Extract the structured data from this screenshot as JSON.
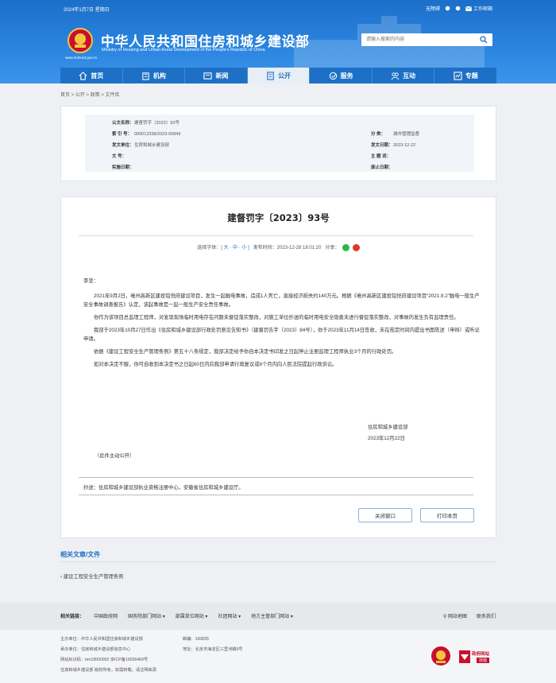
{
  "topbar": {
    "date": "2024年1月7日 星期日",
    "accessibility": "无障碍",
    "weibo": "微博",
    "wechat": "",
    "mail": "工作邮箱"
  },
  "site": {
    "title": "中华人民共和国住房和城乡建设部",
    "subtitle": "Ministry of Housing and Urban-Rural Development of the People's Republic of China",
    "domain": "www.mohurd.gov.cn"
  },
  "search": {
    "placeholder": "请输入搜索的内容"
  },
  "nav": [
    {
      "label": "首页",
      "icon": "home-icon"
    },
    {
      "label": "机构",
      "icon": "building-icon"
    },
    {
      "label": "新闻",
      "icon": "news-icon"
    },
    {
      "label": "公开",
      "icon": "publish-icon"
    },
    {
      "label": "服务",
      "icon": "service-icon"
    },
    {
      "label": "互动",
      "icon": "interact-icon"
    },
    {
      "label": "专题",
      "icon": "topic-icon"
    }
  ],
  "breadcrumb": "首页 > 公开 > 政策 > 文件库",
  "info": {
    "doc_name_label": "公文名称：",
    "doc_name": "建督罚字〔2023〕93号",
    "index_label": "索  引  号：",
    "index": "000013338/2023-00849",
    "issuer_label": "发文单位：",
    "issuer": "住房和城乡建设部",
    "docno_label": "文      号：",
    "docno": "",
    "effective_label": "实施日期：",
    "effective": "",
    "category_label": "分      类：",
    "category": "城市管理监督",
    "date_label": "发文日期：",
    "date": "2023-12-22",
    "keywords_label": "主  题  词：",
    "keywords": "",
    "expiry_label": "废止日期：",
    "expiry": ""
  },
  "doc": {
    "title": "建督罚字〔2023〕93号",
    "font_label": "选择字体：",
    "font_sizes": "[ 大 · 中 · 小 ]",
    "publish": "发布时间：2023-12-28 18:01:20",
    "share_label": "分享：",
    "greeting": "李坚：",
    "paragraphs": [
      "2021年9月2日，亳州高新区建投铂悦府建设项目，发生一起触电事故，造成1人死亡，直接经济损失约140万元。根据《亳州高新区建投铂悦府建设项目“2021.9.2”触电一般生产安全事故调查报告》认定，该起事故是一起一般生产安全责任事故。",
      "你作为该项目总监理工程师，对发现现场临时用电存在问题未督促落实整改，对施工单位抄送的临时用电安全隐患未进行督促落实整改，对事故的发生负有监理责任。",
      "我部于2023年10月27日作出《住房和城乡建设部行政处罚意见告知书》（建督罚告字〔2023〕84号），你于2023年11月14日签收，未在规定时间内提出书面陈述（申辩）或听证申请。",
      "依据《建设工程安全生产管理条例》第五十八条规定，我部决定给予你自本决定书印发之日起停止注册监理工程师执业3个月的行政处罚。",
      "如对本决定不服，你可自收到本决定书之日起60日内向我部申请行政复议或6个月内向人民法院提起行政诉讼。"
    ],
    "sign_org": "住房和城乡建设部",
    "sign_date": "2023年12月22日",
    "public_note": "（此件主动公开）",
    "cc": "抄送：住房和城乡建设部执业资格注册中心，安徽省住房和城乡建设厅。",
    "close_btn": "关闭窗口",
    "print_btn": "打印本页"
  },
  "related": {
    "title": "相关文章/文件",
    "items": [
      "建设工程安全生产管理条例"
    ]
  },
  "links": {
    "label": "相关链接：",
    "items": [
      "中国政府网",
      "国务院部门网站",
      "部属单位网站",
      "社团网站",
      "地方主管部门网站"
    ],
    "sitemap": "网站地图",
    "contact": "联系我们"
  },
  "footer": {
    "sponsor": "主办单位：中华人民共和国住房和城乡建设部",
    "undertaker": "承办单位：住房和城乡建设部信息中心",
    "site_id": "网站标识码：bm18000002     京ICP备10036469号",
    "copyright": "住房和城乡建设部 版权所有，如需转载，请注明来源",
    "postcode": "邮编：100835",
    "address": "地址：北京市海淀区三里河路9号",
    "gov_badge_text": "政府网站",
    "gov_badge_sub": "找错"
  },
  "colors": {
    "brand": "#1d70c6",
    "header": "#2b86e0"
  }
}
